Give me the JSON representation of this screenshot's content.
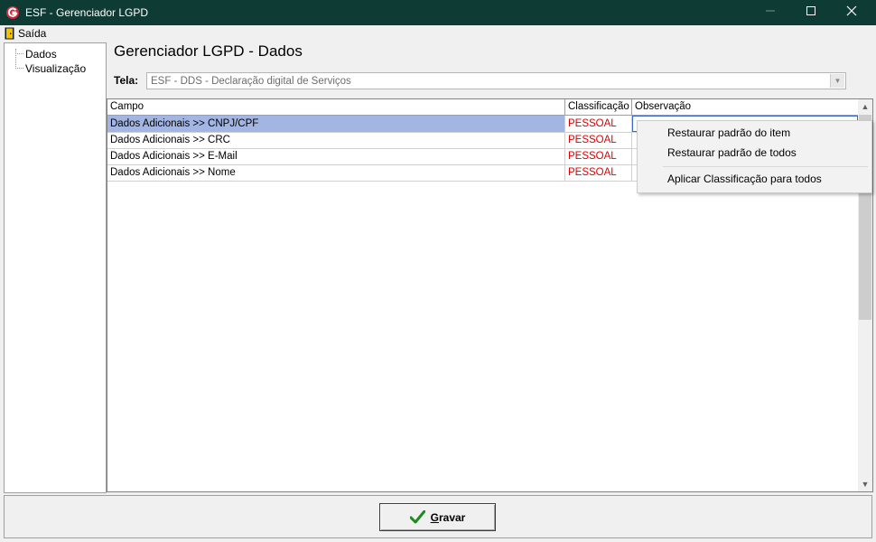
{
  "window": {
    "title": "ESF - Gerenciador LGPD",
    "accent": "#0f3b35"
  },
  "menu": {
    "saida": "Saída"
  },
  "tree": {
    "items": [
      "Dados",
      "Visualização"
    ]
  },
  "page": {
    "heading": "Gerenciador LGPD - Dados"
  },
  "tela": {
    "label": "Tela:",
    "value": "ESF - DDS - Declaração digital de Serviços"
  },
  "grid": {
    "columns": [
      "Campo",
      "Classificação",
      "Observação"
    ],
    "rows": [
      {
        "campo": "Dados Adicionais >> CNPJ/CPF",
        "classificacao": "PESSOAL",
        "observacao": ""
      },
      {
        "campo": "Dados Adicionais >> CRC",
        "classificacao": "PESSOAL",
        "observacao": ""
      },
      {
        "campo": "Dados Adicionais >> E-Mail",
        "classificacao": "PESSOAL",
        "observacao": ""
      },
      {
        "campo": "Dados Adicionais >> Nome",
        "classificacao": "PESSOAL",
        "observacao": ""
      }
    ],
    "selected_row_color": "#a3b6e3",
    "classification_color": "#e00000"
  },
  "context_menu": {
    "items": [
      "Restaurar padrão do item",
      "Restaurar padrão de todos",
      "Aplicar Classificação para todos"
    ]
  },
  "buttons": {
    "gravar_first": "G",
    "gravar_rest": "ravar"
  },
  "icons": {
    "logo": "esf-logo-icon",
    "saida": "exit-door-icon",
    "gravar": "checkmark-icon"
  }
}
